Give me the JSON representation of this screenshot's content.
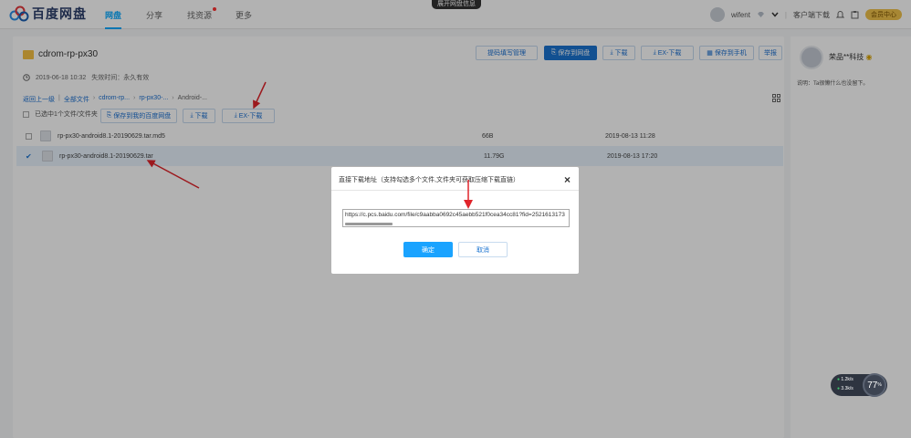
{
  "colors": {
    "accent": "#09aaff",
    "primary": "#1a73d0",
    "arrow": "#e0242b"
  },
  "header": {
    "logo_text": "百度网盘",
    "nav": [
      {
        "label": "网盘",
        "active": true
      },
      {
        "label": "分享"
      },
      {
        "label": "找资源",
        "badge": true
      },
      {
        "label": "更多"
      }
    ],
    "center_tip": "展开网盘信息",
    "username": "wifent",
    "client_download": "客户端下载",
    "vip_label": "会员中心"
  },
  "share": {
    "folder_name": "cdrom-rp-px30",
    "date": "2019-06-18 10:32",
    "expire": "失效时间：永久有效",
    "toolbar": {
      "extract_code": "提码填写管理",
      "save_netdisk": "保存到网盘",
      "download": "下载",
      "ex_download": "EX-下载",
      "save_phone": "保存到手机",
      "report": "举报"
    },
    "breadcrumb": {
      "back": "返回上一级",
      "all": "全部文件",
      "p1": "cdrom-rp...",
      "p2": "rp-px30-...",
      "current": "Android-..."
    },
    "selection_text": "已选中1个文件/文件夹",
    "sel_toolbar": {
      "save": "保存到我的百度网盘",
      "download": "下载",
      "ex_download": "EX-下载"
    },
    "files": [
      {
        "name": "rp-px30-android8.1-20190629.tar.md5",
        "size": "66B",
        "date": "2019-08-13 11:28",
        "selected": false
      },
      {
        "name": "rp-px30-android8.1-20190629.tar",
        "size": "11.79G",
        "date": "2019-08-13 17:20",
        "selected": true
      }
    ]
  },
  "sidebar": {
    "name": "荣品**科技",
    "desc": "说明：Ta很懒什么也没留下。"
  },
  "dialog": {
    "title": "直接下载地址（支持勾选多个文件,文件夹可获取压缩下载直链）",
    "url": "https://c.pcs.baidu.com/file/c9aabba0692c45aebb521f0cea34cc81?fid=2521613173",
    "ok": "确定",
    "cancel": "取消"
  },
  "speed_widget": {
    "up": "1.2k/s",
    "down": "3.3k/s",
    "percent": "77"
  }
}
